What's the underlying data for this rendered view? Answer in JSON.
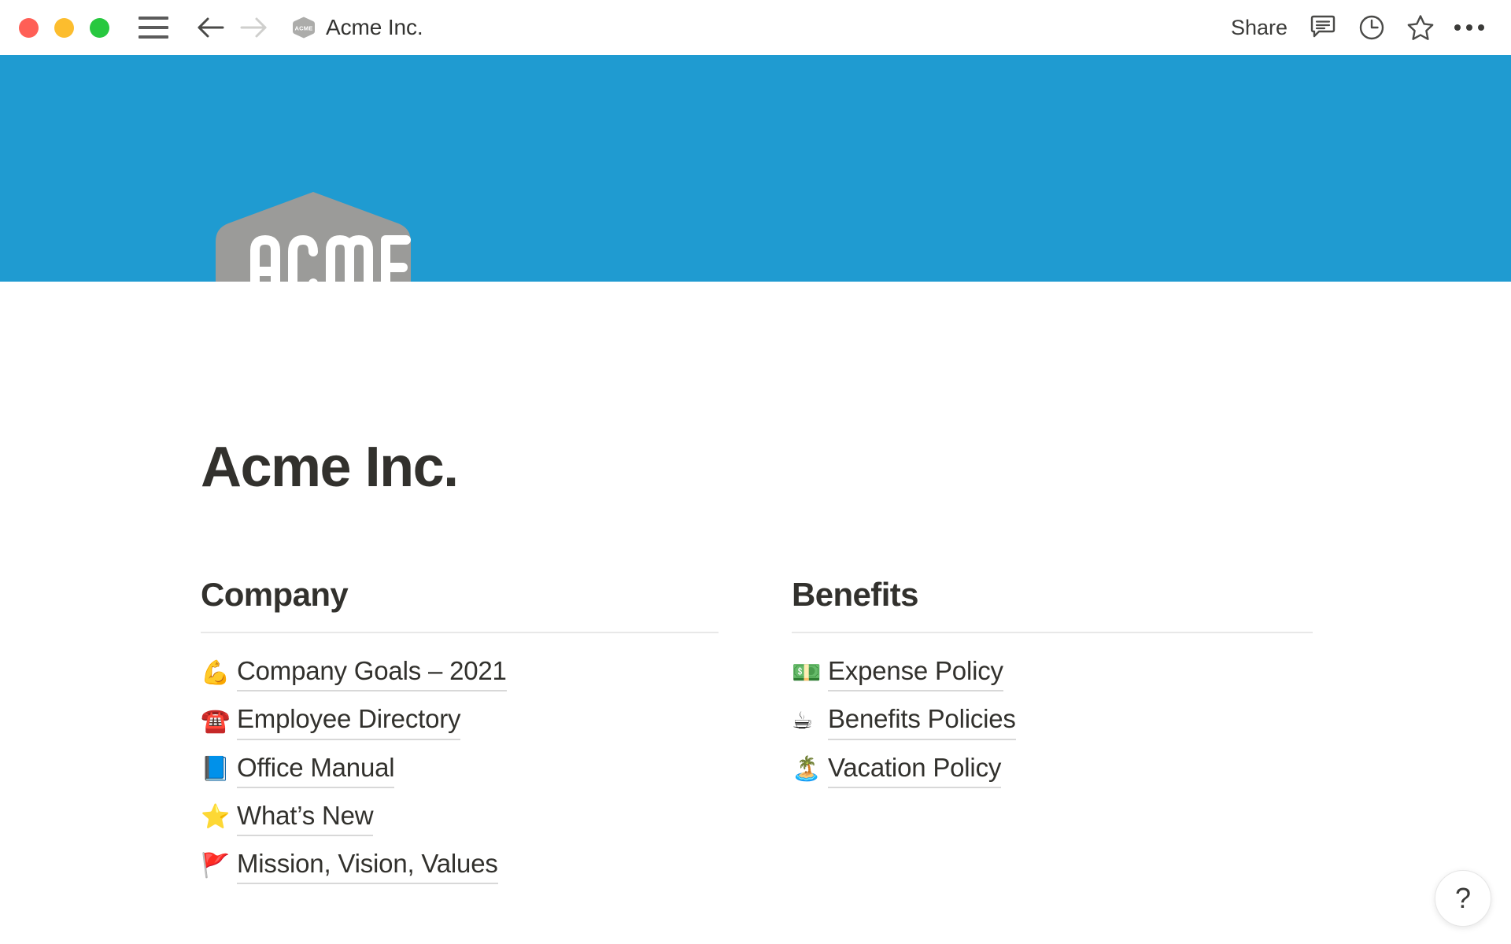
{
  "window": {
    "title": "Acme Inc.",
    "favicon_label": "ACME",
    "traffic_lights": [
      {
        "name": "close",
        "color": "#FF5F56"
      },
      {
        "name": "minimize",
        "color": "#FCBD2E"
      },
      {
        "name": "maximize",
        "color": "#27C83F"
      }
    ],
    "nav": {
      "back_icon": "arrow-left-icon",
      "forward_icon": "arrow-right-icon",
      "menu_icon": "hamburger-menu-icon"
    },
    "actions": {
      "share_label": "Share",
      "comments_icon": "comment-bubble-icon",
      "history_icon": "clock-history-icon",
      "favorite_icon": "star-icon",
      "more_icon": "more-options-icon"
    }
  },
  "banner": {
    "color": "#1F9BD1"
  },
  "logo": {
    "text": "ACME",
    "shape": "rounded-hexagon",
    "fill": "#9B9B99",
    "text_color": "#FFFFFF"
  },
  "page": {
    "title": "Acme Inc."
  },
  "sections": [
    {
      "heading": "Company",
      "links": [
        {
          "emoji": "💪",
          "icon_name": "flexed-biceps-emoji",
          "label": "Company Goals – 2021"
        },
        {
          "emoji": "☎️",
          "icon_name": "telephone-emoji",
          "label": "Employee Directory"
        },
        {
          "emoji": "📘",
          "icon_name": "blue-book-emoji",
          "label": "Office Manual"
        },
        {
          "emoji": "⭐",
          "icon_name": "star-emoji",
          "label": "What’s New"
        },
        {
          "emoji": "🚩",
          "icon_name": "triangular-flag-emoji",
          "label": "Mission, Vision, Values"
        }
      ]
    },
    {
      "heading": "Benefits",
      "links": [
        {
          "emoji": "💵",
          "icon_name": "dollar-banknote-emoji",
          "label": "Expense Policy"
        },
        {
          "emoji": "☕",
          "icon_name": "hot-beverage-emoji",
          "label": "Benefits Policies"
        },
        {
          "emoji": "🏝️",
          "icon_name": "desert-island-emoji",
          "label": "Vacation Policy"
        }
      ]
    }
  ],
  "help": {
    "label": "?"
  }
}
